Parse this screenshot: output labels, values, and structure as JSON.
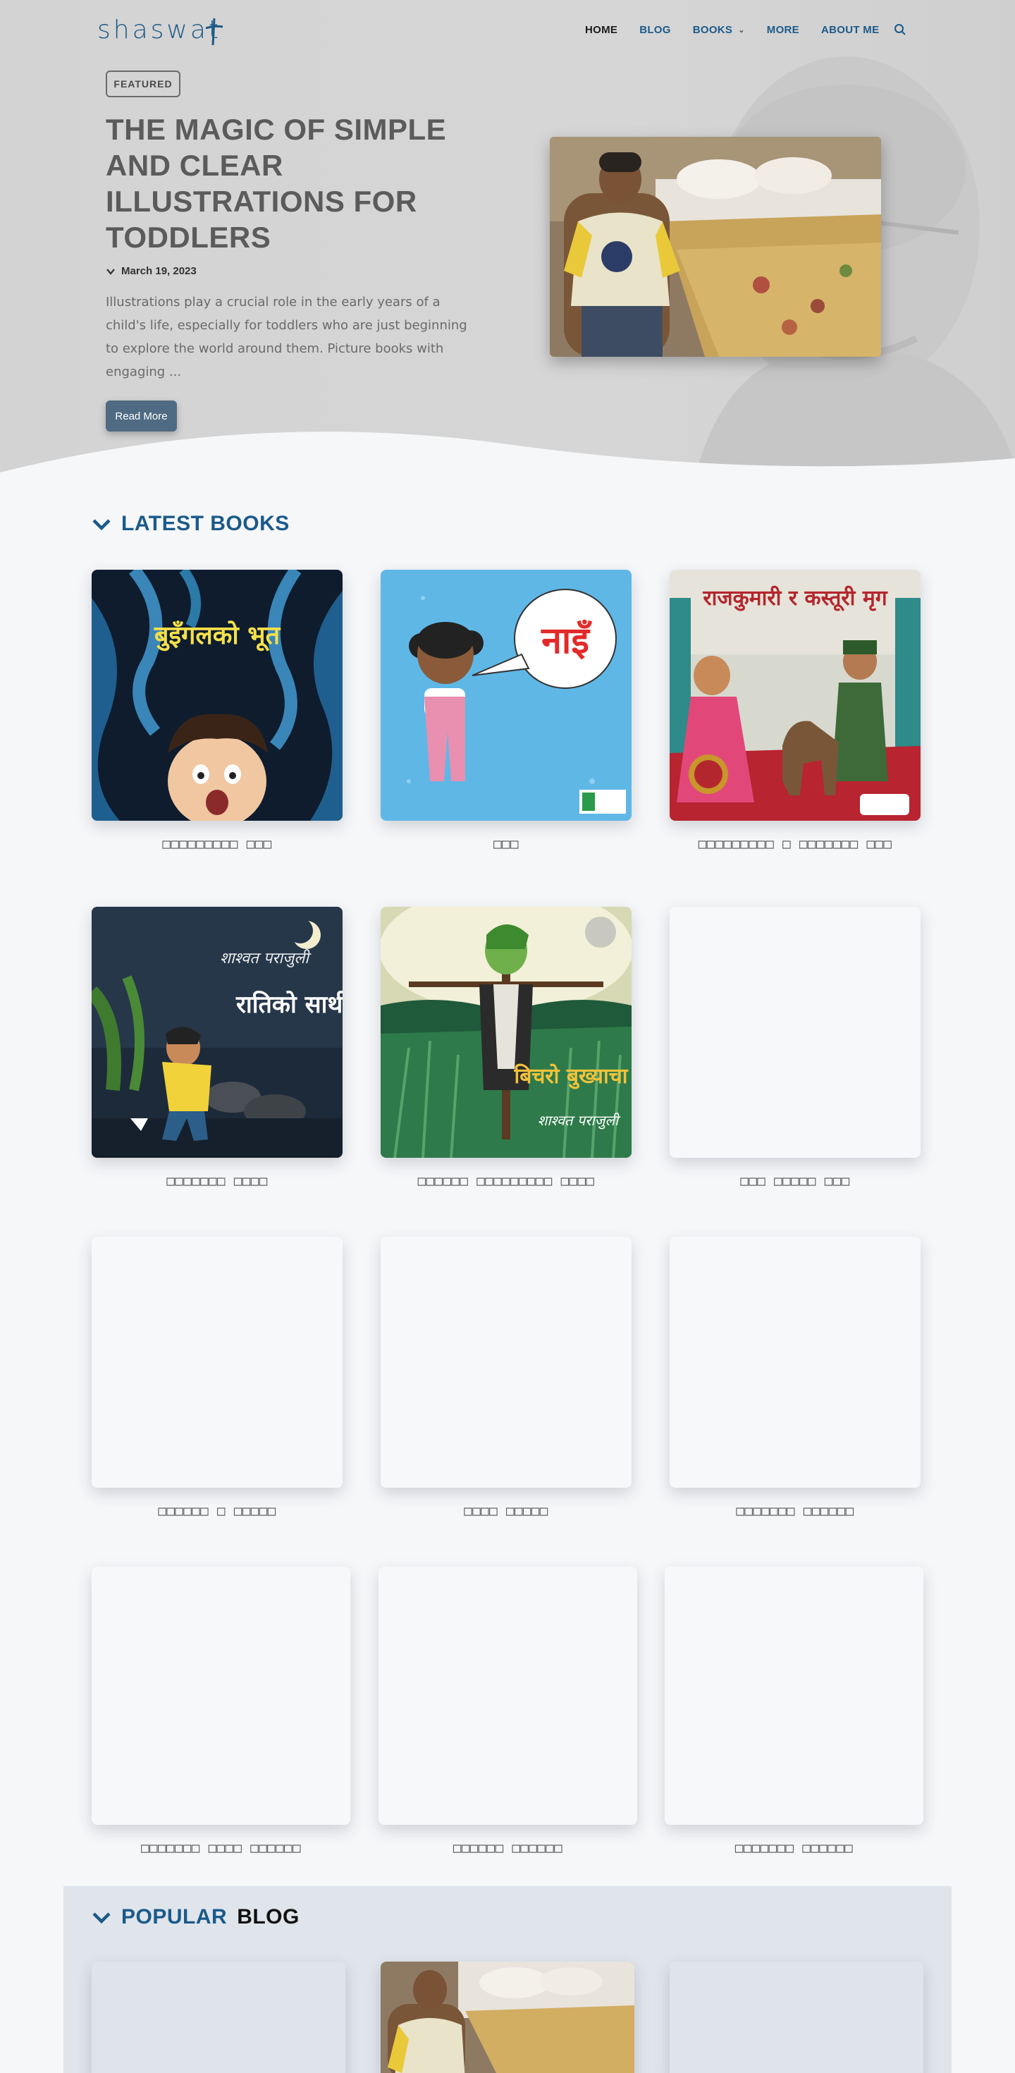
{
  "header": {
    "logo_text": "shaswat",
    "nav": [
      {
        "label": "HOME",
        "accent": false
      },
      {
        "label": "BLOG",
        "accent": true
      },
      {
        "label": "BOOKS",
        "accent": true,
        "has_dropdown": true
      },
      {
        "label": "MORE",
        "accent": true
      },
      {
        "label": "ABOUT ME",
        "accent": true
      }
    ],
    "search_icon": "search-icon"
  },
  "hero": {
    "badge": "FEATURED",
    "title": "THE MAGIC OF SIMPLE AND CLEAR ILLUSTRATIONS FOR TODDLERS",
    "date": "March 19, 2023",
    "excerpt": "Illustrations play a crucial role in the early years of a child's life, especially for toddlers who are just beginning to explore the world around them. Picture books with engaging ...",
    "read_more": "Read More"
  },
  "latest_books": {
    "heading_accent": "LATEST BOOKS",
    "books": [
      {
        "title": "□□□□□□□□□ □□□",
        "cover_text": "बुइँगलको भूत"
      },
      {
        "title": "□□□",
        "cover_text": "नाइँ"
      },
      {
        "title": "□□□□□□□□□ □ □□□□□□□ □□□",
        "cover_text": "राजकुमारी र कस्तूरी मृग"
      },
      {
        "title": "□□□□□□□ □□□□",
        "cover_text": "रातिको साथी"
      },
      {
        "title": "□□□□□□ □□□□□□□□□ □□□□",
        "cover_text": "बिचरो बुख्याचा"
      },
      {
        "title": "□□□ □□□□□ □□□",
        "cover_text": ""
      },
      {
        "title": "□□□□□□ □ □□□□□",
        "cover_text": ""
      },
      {
        "title": "□□□□ □□□□□",
        "cover_text": ""
      },
      {
        "title": "□□□□□□□ □□□□□□",
        "cover_text": ""
      },
      {
        "title": "□□□□□□□ □□□□ □□□□□□",
        "cover_text": ""
      },
      {
        "title": "□□□□□□ □□□□□□",
        "cover_text": ""
      },
      {
        "title": "□□□□□□□ □□□□□□",
        "cover_text": ""
      }
    ]
  },
  "popular_blog": {
    "heading_accent": "POPULAR",
    "heading_dark": "BLOG"
  },
  "colors": {
    "accent": "#1b5a8a",
    "hero_bg": "#d4d4d4",
    "page_bg": "#f6f7f9",
    "button": "#4f6b83"
  }
}
